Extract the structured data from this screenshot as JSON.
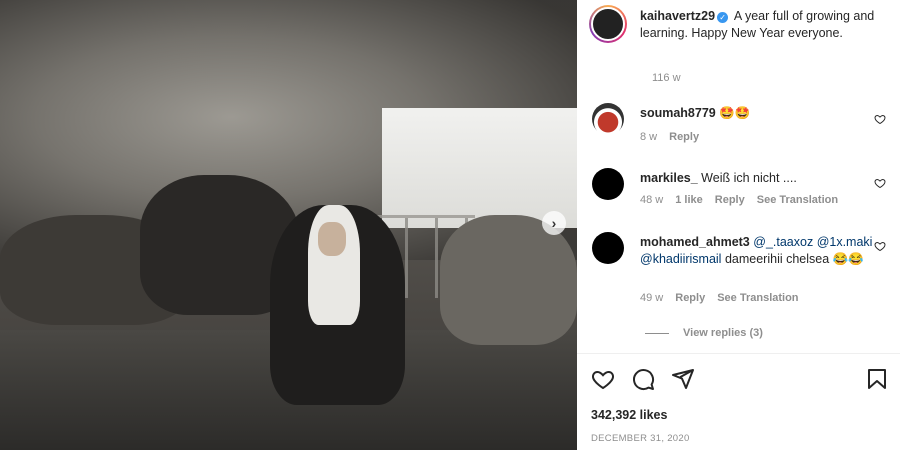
{
  "post": {
    "author": "kaihavertz29",
    "caption": "A year full of growing and learning. Happy New Year everyone.",
    "age": "116 w",
    "likes": "342,392 likes",
    "date": "DECEMBER 31, 2020"
  },
  "comments": [
    {
      "user": "soumah8779",
      "text": "🤩🤩",
      "age": "8 w",
      "likes": "",
      "reply": "Reply",
      "translate": ""
    },
    {
      "user": "markiles_",
      "text": "Weiß ich nicht ....",
      "age": "48 w",
      "likes": "1 like",
      "reply": "Reply",
      "translate": "See Translation"
    },
    {
      "user": "mohamed_ahmet3",
      "mention1": "@_.taaxoz",
      "mention2": "@1x.maki",
      "mention3": "@khadiirismail",
      "text": "dameerihii chelsea 😂😂",
      "age": "49 w",
      "likes": "",
      "reply": "Reply",
      "translate": "See Translation"
    }
  ],
  "view_replies": "View replies (3)",
  "colors": {
    "verified": "#3897f0",
    "muted": "#8e8e8e",
    "mention": "#00376b"
  },
  "icons": [
    "heart-icon",
    "comment-icon",
    "share-icon",
    "bookmark-icon",
    "chevron-right-icon",
    "verified-icon"
  ]
}
